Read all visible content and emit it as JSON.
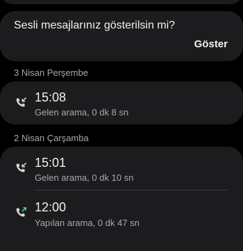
{
  "voicemail_prompt": {
    "question": "Sesli mesajlarınız gösterilsin mi?",
    "action_label": "Göster"
  },
  "call_groups": [
    {
      "date": "3 Nisan Perşembe",
      "calls": [
        {
          "time": "15:08",
          "description": "Gelen arama, 0 dk 8 sn",
          "icon": "incoming-call-icon"
        }
      ]
    },
    {
      "date": "2 Nisan Çarşamba",
      "calls": [
        {
          "time": "15:01",
          "description": "Gelen arama, 0 dk 10 sn",
          "icon": "incoming-call-icon"
        },
        {
          "time": "12:00",
          "description": "Yapılan arama, 0 dk 47 sn",
          "icon": "outgoing-call-icon"
        }
      ]
    }
  ],
  "colors": {
    "background": "#000000",
    "card": "#1c1c1e",
    "secondary_text": "#a9a9ad",
    "outgoing_arrow": "#3ddc84"
  }
}
